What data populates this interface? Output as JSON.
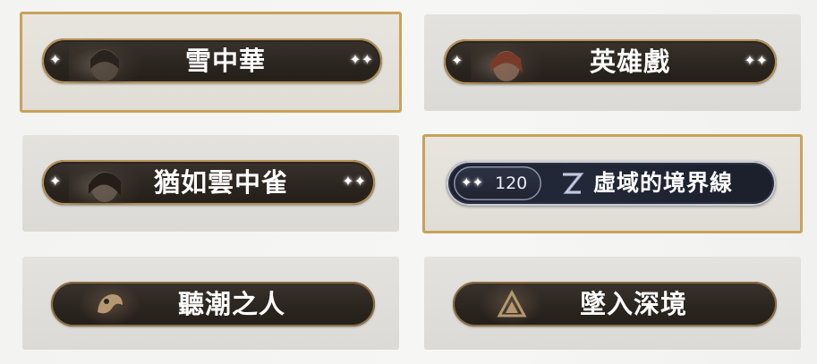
{
  "cards": [
    {
      "title": "雪中華",
      "selected": true,
      "style": "portrait"
    },
    {
      "title": "英雄戲",
      "selected": false,
      "style": "portrait"
    },
    {
      "title": "猶如雲中雀",
      "selected": false,
      "style": "portrait"
    },
    {
      "title": "虛域的境界線",
      "selected": true,
      "style": "silver",
      "badge_value": "120"
    },
    {
      "title": "聽潮之人",
      "selected": false,
      "style": "emblem"
    },
    {
      "title": "墜入深境",
      "selected": false,
      "style": "emblem"
    }
  ],
  "colors": {
    "accent_gold": "#c8a25a",
    "pill_dark": "#2b251f",
    "silver": "#c9ccd6"
  }
}
